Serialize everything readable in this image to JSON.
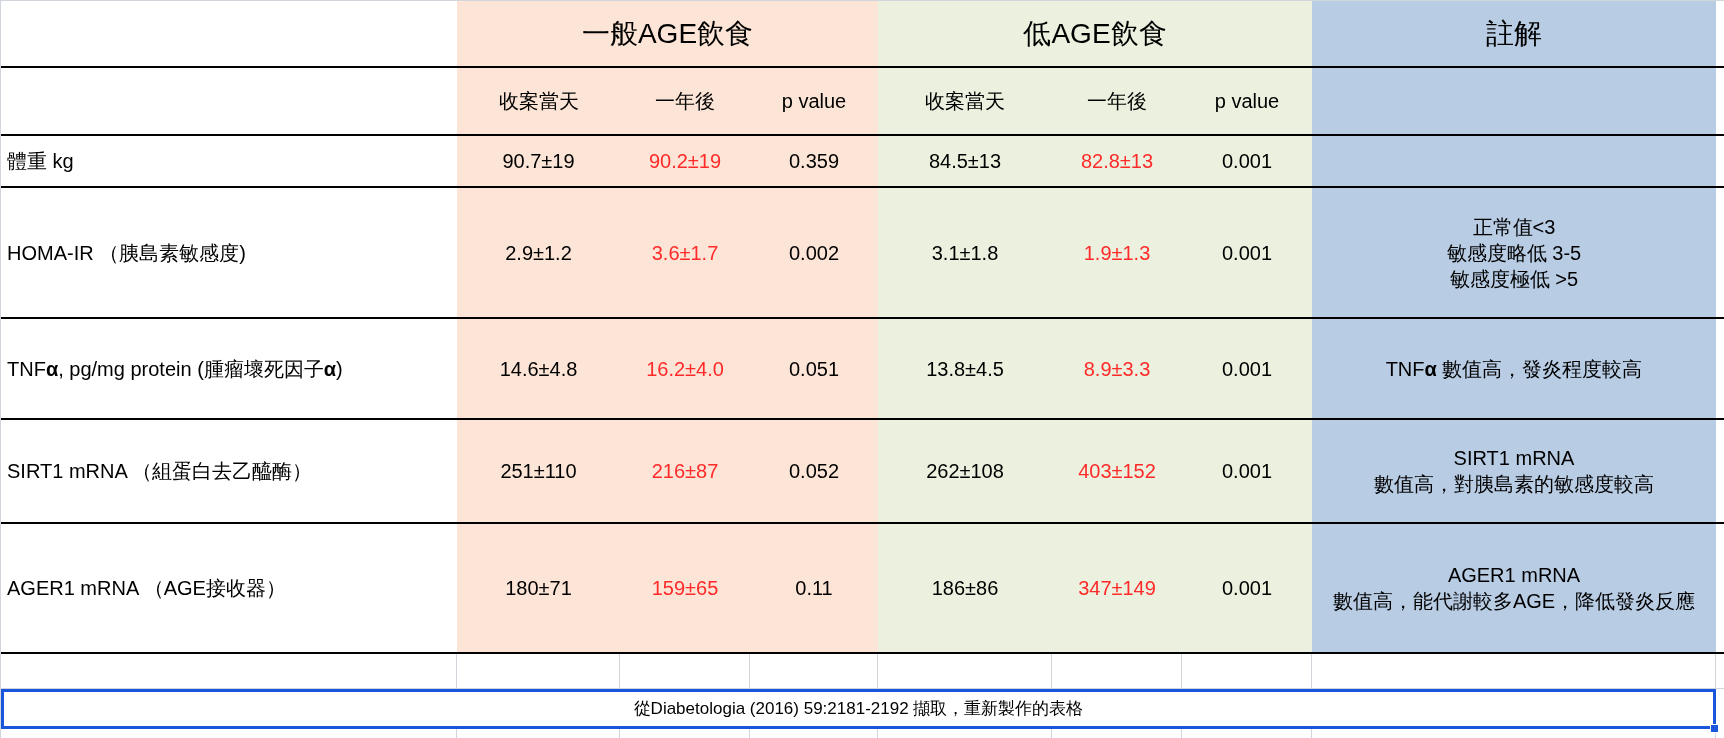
{
  "groups": [
    {
      "label": "一般AGE飲食",
      "color": "#fce4d6"
    },
    {
      "label": "低AGE飲食",
      "color": "#ebf1de"
    }
  ],
  "notes_header": "註解",
  "subheaders": [
    "收案當天",
    "一年後",
    "p value",
    "收案當天",
    "一年後",
    "p value"
  ],
  "rows": [
    {
      "label": "體重 kg",
      "cells": [
        {
          "text": "90.7±19",
          "emphasis": false
        },
        {
          "text": "90.2±19",
          "emphasis": true
        },
        {
          "text": "0.359",
          "emphasis": false
        },
        {
          "text": "84.5±13",
          "emphasis": false
        },
        {
          "text": "82.8±13",
          "emphasis": true
        },
        {
          "text": "0.001",
          "emphasis": false
        }
      ]
    },
    {
      "label": "HOMA-IR （胰島素敏感度)",
      "cells": [
        {
          "text": "2.9±1.2",
          "emphasis": false
        },
        {
          "text": "3.6±1.7",
          "emphasis": true
        },
        {
          "text": "0.002",
          "emphasis": false
        },
        {
          "text": "3.1±1.8",
          "emphasis": false
        },
        {
          "text": "1.9±1.3",
          "emphasis": true
        },
        {
          "text": "0.001",
          "emphasis": false
        }
      ],
      "note": [
        "正常值<3",
        "敏感度略低 3-5",
        "敏感度極低 >5"
      ]
    },
    {
      "label": "TNF**α**, pg/mg protein (腫瘤壞死因子**α**)",
      "cells": [
        {
          "text": "14.6±4.8",
          "emphasis": false
        },
        {
          "text": "16.2±4.0",
          "emphasis": true
        },
        {
          "text": "0.051",
          "emphasis": false
        },
        {
          "text": "13.8±4.5",
          "emphasis": false
        },
        {
          "text": "8.9±3.3",
          "emphasis": true
        },
        {
          "text": "0.001",
          "emphasis": false
        }
      ],
      "note": [
        "TNF**α** 數值高，發炎程度較高"
      ]
    },
    {
      "label": "SIRT1 mRNA （組蛋白去乙醯酶）",
      "cells": [
        {
          "text": "251±110",
          "emphasis": false
        },
        {
          "text": "216±87",
          "emphasis": true
        },
        {
          "text": "0.052",
          "emphasis": false
        },
        {
          "text": "262±108",
          "emphasis": false
        },
        {
          "text": "403±152",
          "emphasis": true
        },
        {
          "text": "0.001",
          "emphasis": false
        }
      ],
      "note": [
        "SIRT1 mRNA",
        "數值高，對胰島素的敏感度較高"
      ]
    },
    {
      "label": "AGER1 mRNA （AGE接收器）",
      "cells": [
        {
          "text": "180±71",
          "emphasis": false
        },
        {
          "text": "159±65",
          "emphasis": true
        },
        {
          "text": "0.11",
          "emphasis": false
        },
        {
          "text": "186±86",
          "emphasis": false
        },
        {
          "text": "347±149",
          "emphasis": true
        },
        {
          "text": "0.001",
          "emphasis": false
        }
      ],
      "note": [
        "AGER1 mRNA",
        "數值高，能代謝較多AGE，降低發炎反應"
      ]
    }
  ],
  "footnote": {
    "text": "從Diabetologia (2016) 59:2181-2192 擷取，重新製作的表格",
    "selected": true
  }
}
